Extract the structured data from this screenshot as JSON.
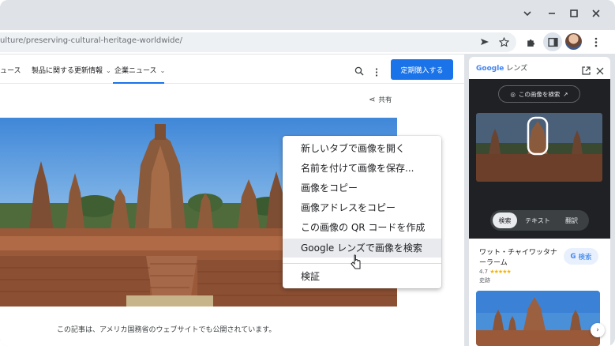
{
  "browser": {
    "url": "ulture/preserving-cultural-heritage-worldwide/",
    "window_controls": [
      "chevron-down-icon",
      "minimize-icon",
      "maximize-icon",
      "close-icon"
    ],
    "toolbar_icons": [
      "send-icon",
      "star-icon",
      "extensions-icon",
      "side-panel-icon",
      "avatar",
      "more-icon"
    ]
  },
  "page": {
    "nav": {
      "items": [
        {
          "label": "ュース"
        },
        {
          "label": "製品に関する更新情報",
          "has_dropdown": true
        },
        {
          "label": "企業ニュース",
          "has_dropdown": true,
          "active": true
        }
      ],
      "buy_label": "定期購入する"
    },
    "share_label": "共有",
    "caption": "この記事は、アメリカ国務省のウェブサイトでも公開されています。"
  },
  "context_menu": {
    "items": [
      {
        "label": "新しいタブで画像を開く"
      },
      {
        "label": "名前を付けて画像を保存..."
      },
      {
        "label": "画像をコピー"
      },
      {
        "label": "画像アドレスをコピー"
      },
      {
        "label": "この画像の QR コードを作成"
      },
      {
        "label": "Google レンズで画像を検索",
        "hovered": true
      },
      {
        "label": "検証"
      }
    ]
  },
  "side_panel": {
    "title_brand": "Google",
    "title_suffix": " レンズ",
    "search_image_label": "この画像を検索",
    "modes": [
      {
        "label": "検索",
        "active": true
      },
      {
        "label": "テキスト"
      },
      {
        "label": "翻訳"
      }
    ],
    "result": {
      "title": "ワット・チャイワッタナーラーム",
      "rating": "4.7",
      "stars": "★★★★★",
      "category": "史跡",
      "search_button": "検索"
    }
  },
  "colors": {
    "accent": "#1a73e8",
    "panel_dark": "#202124",
    "frame": "#dfe3e8"
  }
}
